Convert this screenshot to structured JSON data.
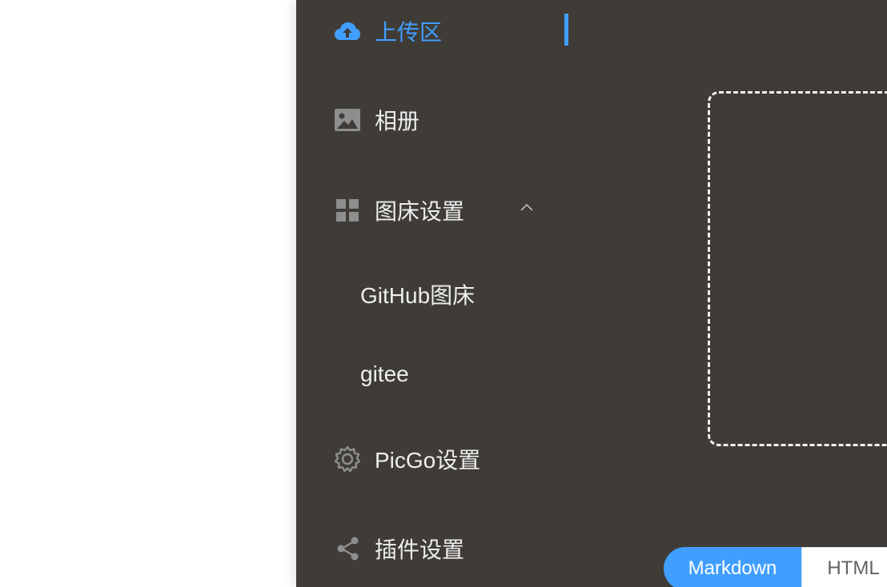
{
  "sidebar": {
    "items": [
      {
        "label": "上传区",
        "icon": "cloud-upload-icon",
        "active": true
      },
      {
        "label": "相册",
        "icon": "image-icon"
      },
      {
        "label": "图床设置",
        "icon": "grid-icon",
        "expanded": true,
        "children": [
          {
            "label": "GitHub图床"
          },
          {
            "label": "gitee"
          }
        ]
      },
      {
        "label": "PicGo设置",
        "icon": "gear-icon"
      },
      {
        "label": "插件设置",
        "icon": "share-icon"
      }
    ]
  },
  "link_format": {
    "options": [
      "Markdown",
      "HTML"
    ],
    "selected": "Markdown"
  },
  "colors": {
    "sidebar_bg": "#3f3c38",
    "accent": "#409eff",
    "text": "#eeeeee",
    "icon": "#8e8e8e"
  }
}
